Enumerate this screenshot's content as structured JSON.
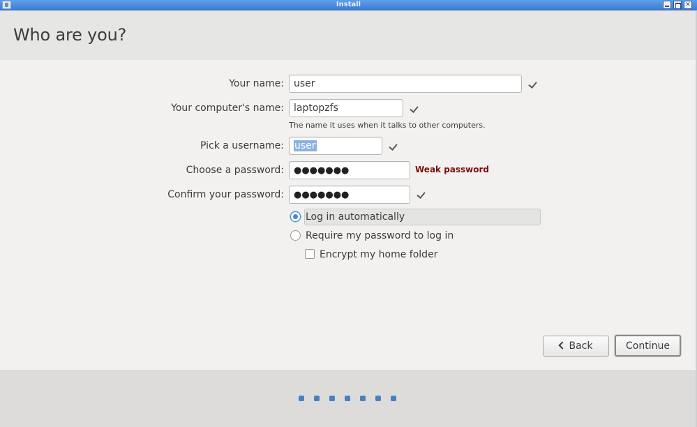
{
  "window": {
    "title": "Install"
  },
  "header": {
    "title": "Who are you?"
  },
  "form": {
    "name_label": "Your name:",
    "name_value": "user",
    "computer_label": "Your computer's name:",
    "computer_value": "laptopzfs",
    "computer_hint": "The name it uses when it talks to other computers.",
    "username_label": "Pick a username:",
    "username_value": "user",
    "password_label": "Choose a password:",
    "password_value": "●●●●●●●",
    "password_strength": "Weak password",
    "confirm_label": "Confirm your password:",
    "confirm_value": "●●●●●●●",
    "option_auto_login": "Log in automatically",
    "option_require_password": "Require my password to log in",
    "option_encrypt_home": "Encrypt my home folder",
    "selected_login_option": "Log in automatically",
    "encrypt_checked": false
  },
  "buttons": {
    "back": "Back",
    "continue": "Continue"
  },
  "progress": {
    "total_steps": 7
  },
  "colors": {
    "accent": "#4a86cf",
    "warning": "#7c0d0d",
    "titlebar": "#3b7dd6"
  }
}
